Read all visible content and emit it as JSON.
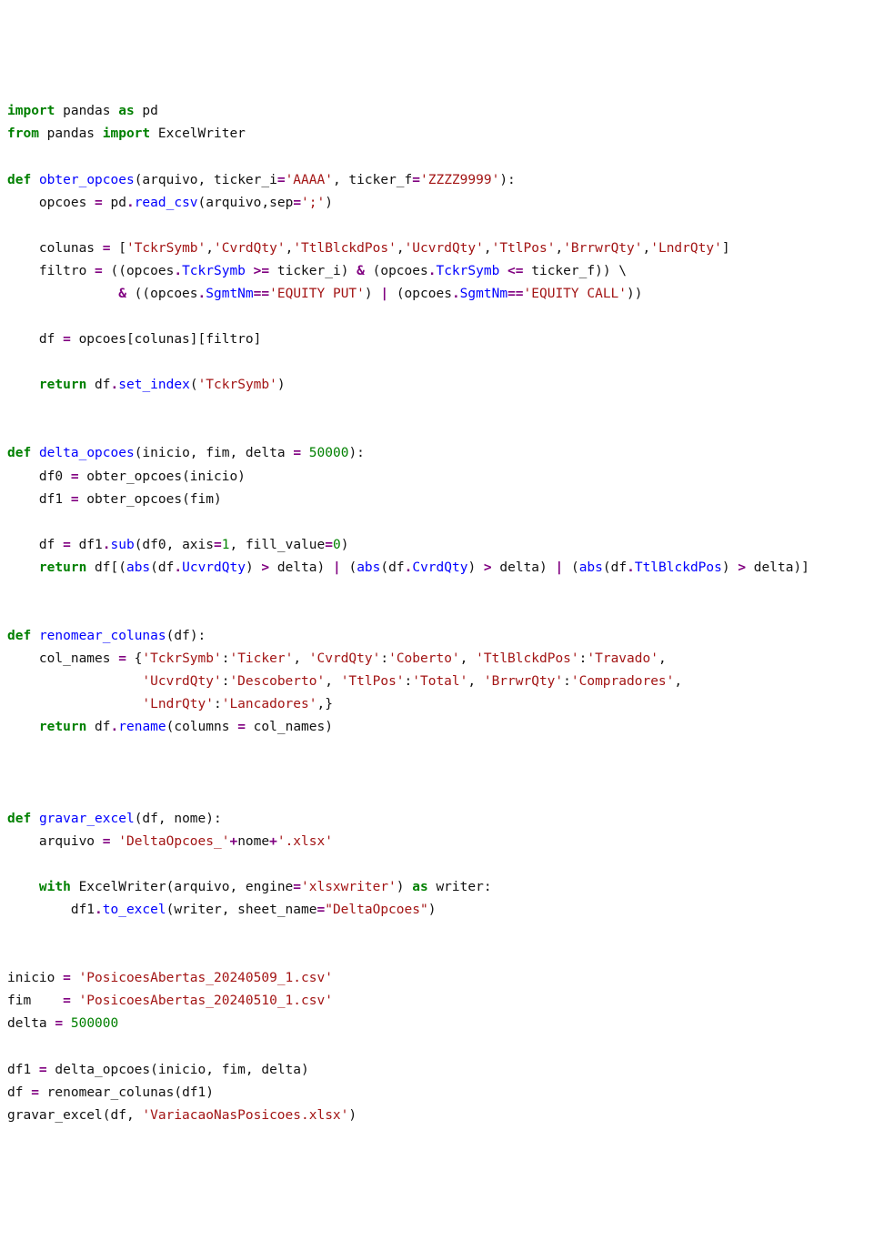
{
  "code": {
    "lines": [
      [
        [
          "kw",
          "import"
        ],
        [
          "blk",
          " pandas "
        ],
        [
          "kw",
          "as"
        ],
        [
          "blk",
          " pd"
        ]
      ],
      [
        [
          "kw",
          "from"
        ],
        [
          "blk",
          " pandas "
        ],
        [
          "kw",
          "import"
        ],
        [
          "blk",
          " ExcelWriter"
        ]
      ],
      [],
      [
        [
          "kw",
          "def"
        ],
        [
          "blk",
          " "
        ],
        [
          "idb",
          "obter_opcoes"
        ],
        [
          "blk",
          "(arquivo, ticker_i"
        ],
        [
          "op",
          "="
        ],
        [
          "str",
          "'AAAA'"
        ],
        [
          "blk",
          ", ticker_f"
        ],
        [
          "op",
          "="
        ],
        [
          "str",
          "'ZZZZ9999'"
        ],
        [
          "blk",
          "):"
        ]
      ],
      [
        [
          "blk",
          "    opcoes "
        ],
        [
          "op",
          "="
        ],
        [
          "blk",
          " pd"
        ],
        [
          "op",
          "."
        ],
        [
          "idb",
          "read_csv"
        ],
        [
          "blk",
          "(arquivo,sep"
        ],
        [
          "op",
          "="
        ],
        [
          "str",
          "';'"
        ],
        [
          "blk",
          ")"
        ]
      ],
      [],
      [
        [
          "blk",
          "    colunas "
        ],
        [
          "op",
          "="
        ],
        [
          "blk",
          " ["
        ],
        [
          "str",
          "'TckrSymb'"
        ],
        [
          "blk",
          ","
        ],
        [
          "str",
          "'CvrdQty'"
        ],
        [
          "blk",
          ","
        ],
        [
          "str",
          "'TtlBlckdPos'"
        ],
        [
          "blk",
          ","
        ],
        [
          "str",
          "'UcvrdQty'"
        ],
        [
          "blk",
          ","
        ],
        [
          "str",
          "'TtlPos'"
        ],
        [
          "blk",
          ","
        ],
        [
          "str",
          "'BrrwrQty'"
        ],
        [
          "blk",
          ","
        ],
        [
          "str",
          "'LndrQty'"
        ],
        [
          "blk",
          "]"
        ]
      ],
      [
        [
          "blk",
          "    filtro "
        ],
        [
          "op",
          "="
        ],
        [
          "blk",
          " ((opcoes"
        ],
        [
          "op",
          "."
        ],
        [
          "idb",
          "TckrSymb"
        ],
        [
          "blk",
          " "
        ],
        [
          "op",
          ">="
        ],
        [
          "blk",
          " ticker_i) "
        ],
        [
          "op",
          "&"
        ],
        [
          "blk",
          " (opcoes"
        ],
        [
          "op",
          "."
        ],
        [
          "idb",
          "TckrSymb"
        ],
        [
          "blk",
          " "
        ],
        [
          "op",
          "<="
        ],
        [
          "blk",
          " ticker_f)) \\"
        ]
      ],
      [
        [
          "blk",
          "              "
        ],
        [
          "op",
          "&"
        ],
        [
          "blk",
          " ((opcoes"
        ],
        [
          "op",
          "."
        ],
        [
          "idb",
          "SgmtNm"
        ],
        [
          "op",
          "=="
        ],
        [
          "str",
          "'EQUITY PUT'"
        ],
        [
          "blk",
          ") "
        ],
        [
          "op",
          "|"
        ],
        [
          "blk",
          " (opcoes"
        ],
        [
          "op",
          "."
        ],
        [
          "idb",
          "SgmtNm"
        ],
        [
          "op",
          "=="
        ],
        [
          "str",
          "'EQUITY CALL'"
        ],
        [
          "blk",
          "))"
        ]
      ],
      [],
      [
        [
          "blk",
          "    df "
        ],
        [
          "op",
          "="
        ],
        [
          "blk",
          " opcoes[colunas][filtro]"
        ]
      ],
      [],
      [
        [
          "blk",
          "    "
        ],
        [
          "kw",
          "return"
        ],
        [
          "blk",
          " df"
        ],
        [
          "op",
          "."
        ],
        [
          "idb",
          "set_index"
        ],
        [
          "blk",
          "("
        ],
        [
          "str",
          "'TckrSymb'"
        ],
        [
          "blk",
          ")"
        ]
      ],
      [],
      [],
      [
        [
          "kw",
          "def"
        ],
        [
          "blk",
          " "
        ],
        [
          "idb",
          "delta_opcoes"
        ],
        [
          "blk",
          "(inicio, fim, delta "
        ],
        [
          "op",
          "="
        ],
        [
          "blk",
          " "
        ],
        [
          "num",
          "50000"
        ],
        [
          "blk",
          "):"
        ]
      ],
      [
        [
          "blk",
          "    df0 "
        ],
        [
          "op",
          "="
        ],
        [
          "blk",
          " obter_opcoes(inicio)"
        ]
      ],
      [
        [
          "blk",
          "    df1 "
        ],
        [
          "op",
          "="
        ],
        [
          "blk",
          " obter_opcoes(fim)"
        ]
      ],
      [],
      [
        [
          "blk",
          "    df "
        ],
        [
          "op",
          "="
        ],
        [
          "blk",
          " df1"
        ],
        [
          "op",
          "."
        ],
        [
          "idb",
          "sub"
        ],
        [
          "blk",
          "(df0, axis"
        ],
        [
          "op",
          "="
        ],
        [
          "num",
          "1"
        ],
        [
          "blk",
          ", fill_value"
        ],
        [
          "op",
          "="
        ],
        [
          "num",
          "0"
        ],
        [
          "blk",
          ")"
        ]
      ],
      [
        [
          "blk",
          "    "
        ],
        [
          "kw",
          "return"
        ],
        [
          "blk",
          " df[("
        ],
        [
          "idb",
          "abs"
        ],
        [
          "blk",
          "(df"
        ],
        [
          "op",
          "."
        ],
        [
          "idb",
          "UcvrdQty"
        ],
        [
          "blk",
          ") "
        ],
        [
          "op",
          ">"
        ],
        [
          "blk",
          " delta) "
        ],
        [
          "op",
          "|"
        ],
        [
          "blk",
          " ("
        ],
        [
          "idb",
          "abs"
        ],
        [
          "blk",
          "(df"
        ],
        [
          "op",
          "."
        ],
        [
          "idb",
          "CvrdQty"
        ],
        [
          "blk",
          ") "
        ],
        [
          "op",
          ">"
        ],
        [
          "blk",
          " delta) "
        ],
        [
          "op",
          "|"
        ],
        [
          "blk",
          " ("
        ],
        [
          "idb",
          "abs"
        ],
        [
          "blk",
          "(df"
        ],
        [
          "op",
          "."
        ],
        [
          "idb",
          "TtlBlckdPos"
        ],
        [
          "blk",
          ") "
        ],
        [
          "op",
          ">"
        ],
        [
          "blk",
          " delta)]"
        ]
      ],
      [],
      [],
      [
        [
          "kw",
          "def"
        ],
        [
          "blk",
          " "
        ],
        [
          "idb",
          "renomear_colunas"
        ],
        [
          "blk",
          "(df):"
        ]
      ],
      [
        [
          "blk",
          "    col_names "
        ],
        [
          "op",
          "="
        ],
        [
          "blk",
          " {"
        ],
        [
          "str",
          "'TckrSymb'"
        ],
        [
          "blk",
          ":"
        ],
        [
          "str",
          "'Ticker'"
        ],
        [
          "blk",
          ", "
        ],
        [
          "str",
          "'CvrdQty'"
        ],
        [
          "blk",
          ":"
        ],
        [
          "str",
          "'Coberto'"
        ],
        [
          "blk",
          ", "
        ],
        [
          "str",
          "'TtlBlckdPos'"
        ],
        [
          "blk",
          ":"
        ],
        [
          "str",
          "'Travado'"
        ],
        [
          "blk",
          ","
        ]
      ],
      [
        [
          "blk",
          "                 "
        ],
        [
          "str",
          "'UcvrdQty'"
        ],
        [
          "blk",
          ":"
        ],
        [
          "str",
          "'Descoberto'"
        ],
        [
          "blk",
          ", "
        ],
        [
          "str",
          "'TtlPos'"
        ],
        [
          "blk",
          ":"
        ],
        [
          "str",
          "'Total'"
        ],
        [
          "blk",
          ", "
        ],
        [
          "str",
          "'BrrwrQty'"
        ],
        [
          "blk",
          ":"
        ],
        [
          "str",
          "'Compradores'"
        ],
        [
          "blk",
          ","
        ]
      ],
      [
        [
          "blk",
          "                 "
        ],
        [
          "str",
          "'LndrQty'"
        ],
        [
          "blk",
          ":"
        ],
        [
          "str",
          "'Lancadores'"
        ],
        [
          "blk",
          ",}"
        ]
      ],
      [
        [
          "blk",
          "    "
        ],
        [
          "kw",
          "return"
        ],
        [
          "blk",
          " df"
        ],
        [
          "op",
          "."
        ],
        [
          "idb",
          "rename"
        ],
        [
          "blk",
          "(columns "
        ],
        [
          "op",
          "="
        ],
        [
          "blk",
          " col_names)"
        ]
      ],
      [],
      [],
      [],
      [
        [
          "kw",
          "def"
        ],
        [
          "blk",
          " "
        ],
        [
          "idb",
          "gravar_excel"
        ],
        [
          "blk",
          "(df, nome):"
        ]
      ],
      [
        [
          "blk",
          "    arquivo "
        ],
        [
          "op",
          "="
        ],
        [
          "blk",
          " "
        ],
        [
          "str",
          "'DeltaOpcoes_'"
        ],
        [
          "op",
          "+"
        ],
        [
          "blk",
          "nome"
        ],
        [
          "op",
          "+"
        ],
        [
          "str",
          "'.xlsx'"
        ]
      ],
      [],
      [
        [
          "blk",
          "    "
        ],
        [
          "kw",
          "with"
        ],
        [
          "blk",
          " ExcelWriter(arquivo, engine"
        ],
        [
          "op",
          "="
        ],
        [
          "str",
          "'xlsxwriter'"
        ],
        [
          "blk",
          ") "
        ],
        [
          "kw",
          "as"
        ],
        [
          "blk",
          " writer:"
        ]
      ],
      [
        [
          "blk",
          "        df1"
        ],
        [
          "op",
          "."
        ],
        [
          "idb",
          "to_excel"
        ],
        [
          "blk",
          "(writer, sheet_name"
        ],
        [
          "op",
          "="
        ],
        [
          "str",
          "\"DeltaOpcoes\""
        ],
        [
          "blk",
          ")"
        ]
      ],
      [],
      [],
      [
        [
          "blk",
          "inicio "
        ],
        [
          "op",
          "="
        ],
        [
          "blk",
          " "
        ],
        [
          "str",
          "'PosicoesAbertas_20240509_1.csv'"
        ]
      ],
      [
        [
          "blk",
          "fim    "
        ],
        [
          "op",
          "="
        ],
        [
          "blk",
          " "
        ],
        [
          "str",
          "'PosicoesAbertas_20240510_1.csv'"
        ]
      ],
      [
        [
          "blk",
          "delta "
        ],
        [
          "op",
          "="
        ],
        [
          "blk",
          " "
        ],
        [
          "num",
          "500000"
        ]
      ],
      [],
      [
        [
          "blk",
          "df1 "
        ],
        [
          "op",
          "="
        ],
        [
          "blk",
          " delta_opcoes(inicio, fim, delta)"
        ]
      ],
      [
        [
          "blk",
          "df "
        ],
        [
          "op",
          "="
        ],
        [
          "blk",
          " renomear_colunas(df1)"
        ]
      ],
      [
        [
          "blk",
          "gravar_excel(df, "
        ],
        [
          "str",
          "'VariacaoNasPosicoes.xlsx'"
        ],
        [
          "blk",
          ")"
        ]
      ]
    ]
  }
}
